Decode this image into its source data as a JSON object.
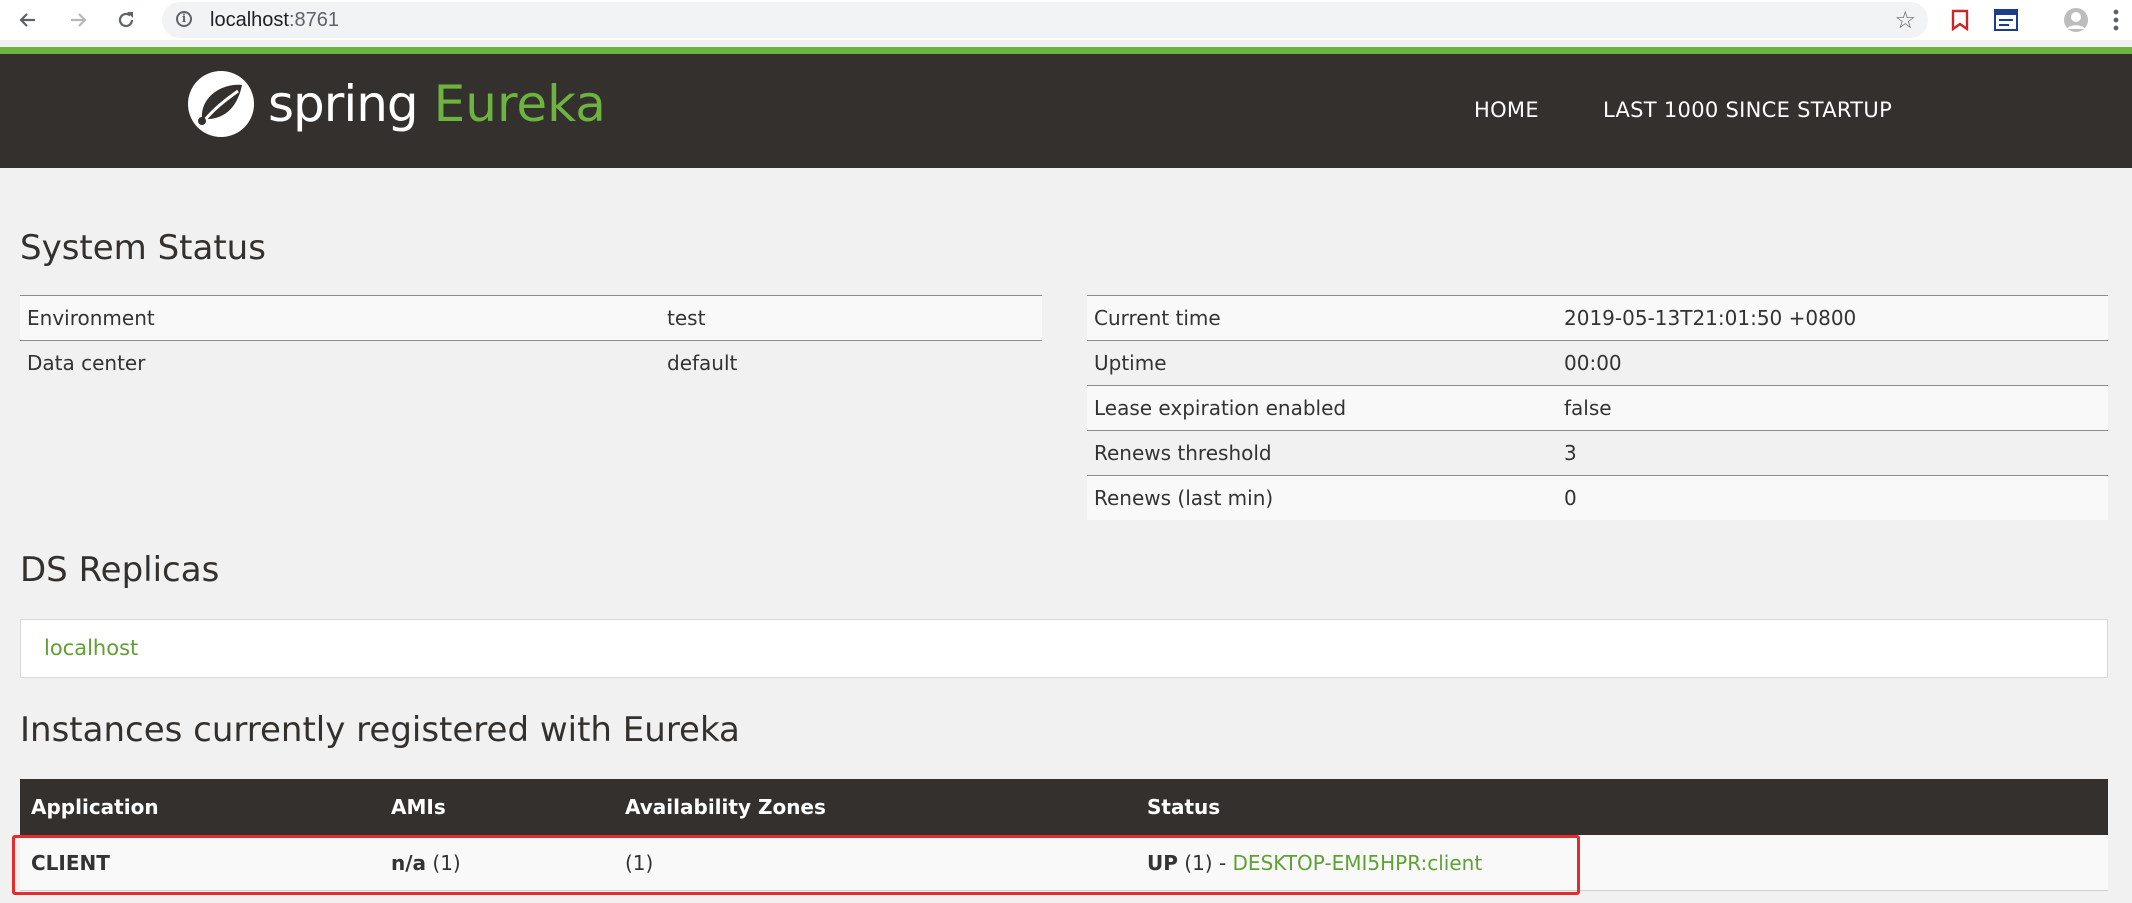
{
  "browser": {
    "url_host": "localhost",
    "url_port": ":8761"
  },
  "header": {
    "logo_spring": "spring",
    "logo_eureka": "Eureka",
    "nav": [
      "HOME",
      "LAST 1000 SINCE STARTUP"
    ]
  },
  "system_status": {
    "title": "System Status",
    "left": [
      {
        "label": "Environment",
        "value": "test"
      },
      {
        "label": "Data center",
        "value": "default"
      }
    ],
    "right": [
      {
        "label": "Current time",
        "value": "2019-05-13T21:01:50 +0800"
      },
      {
        "label": "Uptime",
        "value": "00:00"
      },
      {
        "label": "Lease expiration enabled",
        "value": "false"
      },
      {
        "label": "Renews threshold",
        "value": "3"
      },
      {
        "label": "Renews (last min)",
        "value": "0"
      }
    ]
  },
  "ds_replicas": {
    "title": "DS Replicas",
    "items": [
      "localhost"
    ]
  },
  "instances": {
    "title": "Instances currently registered with Eureka",
    "columns": [
      "Application",
      "AMIs",
      "Availability Zones",
      "Status"
    ],
    "rows": [
      {
        "application": "CLIENT",
        "amis_label": "n/a",
        "amis_count": "(1)",
        "zones": "(1)",
        "status_label": "UP",
        "status_count": "(1) -",
        "instance_link": "DESKTOP-EMI5HPR:client"
      }
    ]
  },
  "colors": {
    "accent_green": "#6db33f",
    "header_bg": "#34302d",
    "highlight_red": "#e52b2b"
  }
}
